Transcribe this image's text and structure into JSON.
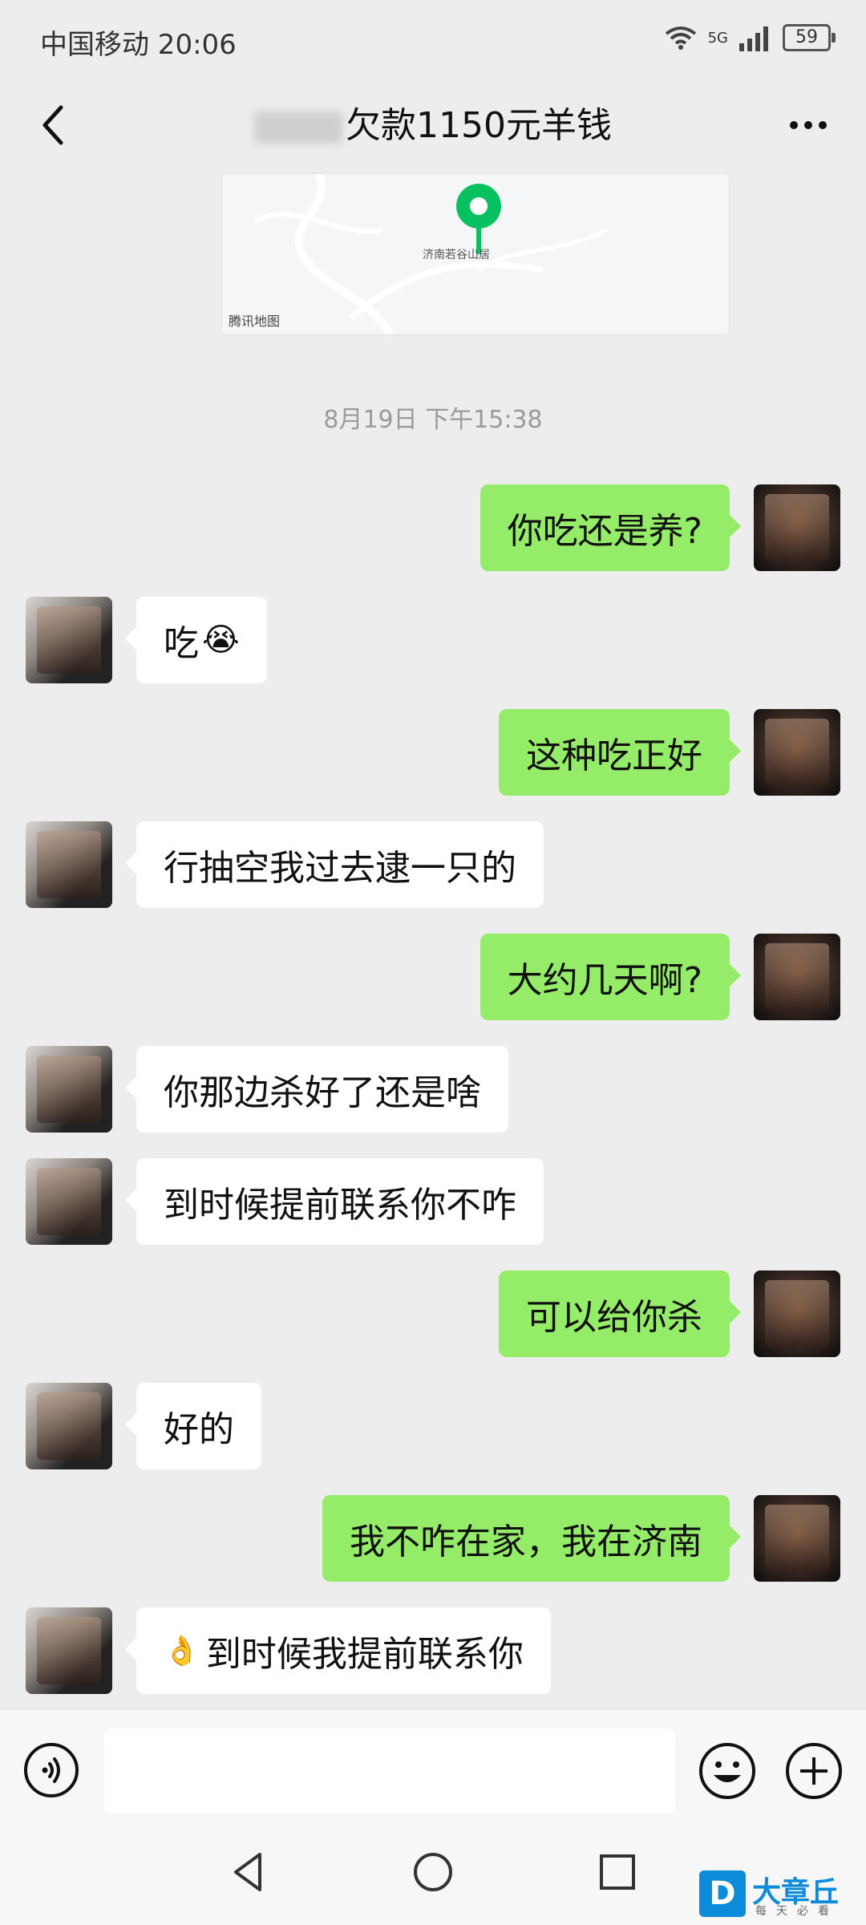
{
  "status_bar": {
    "carrier_time": "中国移动 20:06",
    "network": "5G",
    "battery": "59"
  },
  "header": {
    "title": "欠款1150元羊钱"
  },
  "map": {
    "place": "济南若谷山居",
    "provider": "腾讯地图"
  },
  "timestamp": "8月19日 下午15:38",
  "messages": [
    {
      "side": "right",
      "text": "你吃还是养?"
    },
    {
      "side": "left",
      "text": "吃",
      "emoji": "😭"
    },
    {
      "side": "right",
      "text": "这种吃正好"
    },
    {
      "side": "left",
      "text": "行抽空我过去逮一只的"
    },
    {
      "side": "right",
      "text": "大约几天啊?"
    },
    {
      "side": "left",
      "text": "你那边杀好了还是啥"
    },
    {
      "side": "left",
      "text": "到时候提前联系你不咋"
    },
    {
      "side": "right",
      "text": "可以给你杀"
    },
    {
      "side": "left",
      "text": "好的"
    },
    {
      "side": "right",
      "text": "我不咋在家，我在济南"
    },
    {
      "side": "left",
      "text": "到时候我提前联系你",
      "emoji": "👌"
    }
  ],
  "watermark": {
    "logo": "D",
    "text": "大章丘",
    "subtitle": "每天必看"
  },
  "colors": {
    "background": "#ededed",
    "sent_bubble": "#95ec69",
    "received_bubble": "#ffffff",
    "watermark": "#0b8bd9"
  }
}
